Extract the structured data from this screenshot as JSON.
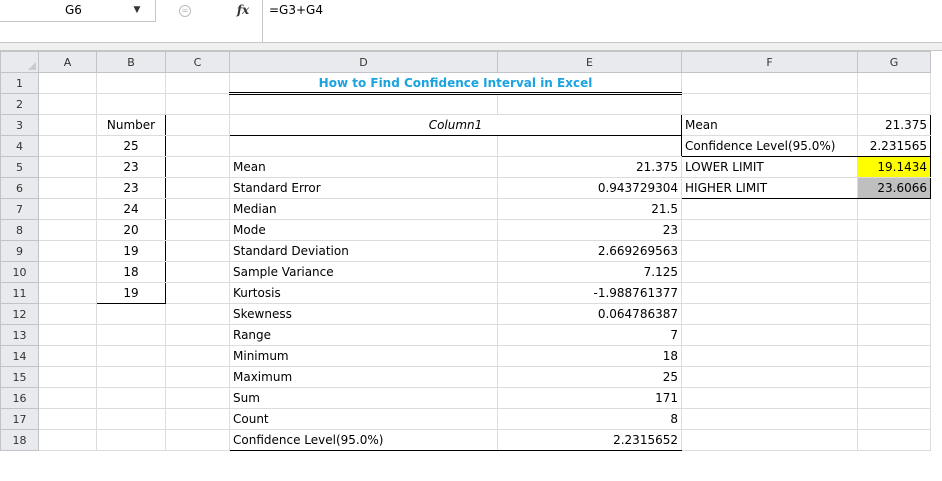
{
  "formula_bar": {
    "cell_ref": "G6",
    "formula": "=G3+G4"
  },
  "columns": [
    "A",
    "B",
    "C",
    "D",
    "E",
    "F",
    "G"
  ],
  "rows": [
    "1",
    "2",
    "3",
    "4",
    "5",
    "6",
    "7",
    "8",
    "9",
    "10",
    "11",
    "12",
    "13",
    "14",
    "15",
    "16",
    "17",
    "18"
  ],
  "title": "How to Find Confidence Interval in Excel",
  "number_list": {
    "header": "Number",
    "values": [
      "25",
      "23",
      "23",
      "24",
      "20",
      "19",
      "18",
      "19"
    ]
  },
  "stats_table": {
    "header": "Column1",
    "rows": [
      {
        "label": "Mean",
        "value": "21.375"
      },
      {
        "label": "Standard Error",
        "value": "0.943729304"
      },
      {
        "label": "Median",
        "value": "21.5"
      },
      {
        "label": "Mode",
        "value": "23"
      },
      {
        "label": "Standard Deviation",
        "value": "2.669269563"
      },
      {
        "label": "Sample Variance",
        "value": "7.125"
      },
      {
        "label": "Kurtosis",
        "value": "-1.988761377"
      },
      {
        "label": "Skewness",
        "value": "0.064786387"
      },
      {
        "label": "Range",
        "value": "7"
      },
      {
        "label": "Minimum",
        "value": "18"
      },
      {
        "label": "Maximum",
        "value": "25"
      },
      {
        "label": "Sum",
        "value": "171"
      },
      {
        "label": "Count",
        "value": "8"
      },
      {
        "label": "Confidence Level(95.0%)",
        "value": "2.2315652"
      }
    ]
  },
  "summary": {
    "mean_label": "Mean",
    "mean_value": "21.375",
    "conf_label": "Confidence Level(95.0%)",
    "conf_value": "2.231565",
    "lower_label": "LOWER LIMIT",
    "lower_value": "19.1434",
    "higher_label": "HIGHER LIMIT",
    "higher_value": "23.6066"
  },
  "colors": {
    "title": "#1aa3e0",
    "lower_highlight": "#ffff00",
    "higher_highlight": "#bfbfbf"
  }
}
